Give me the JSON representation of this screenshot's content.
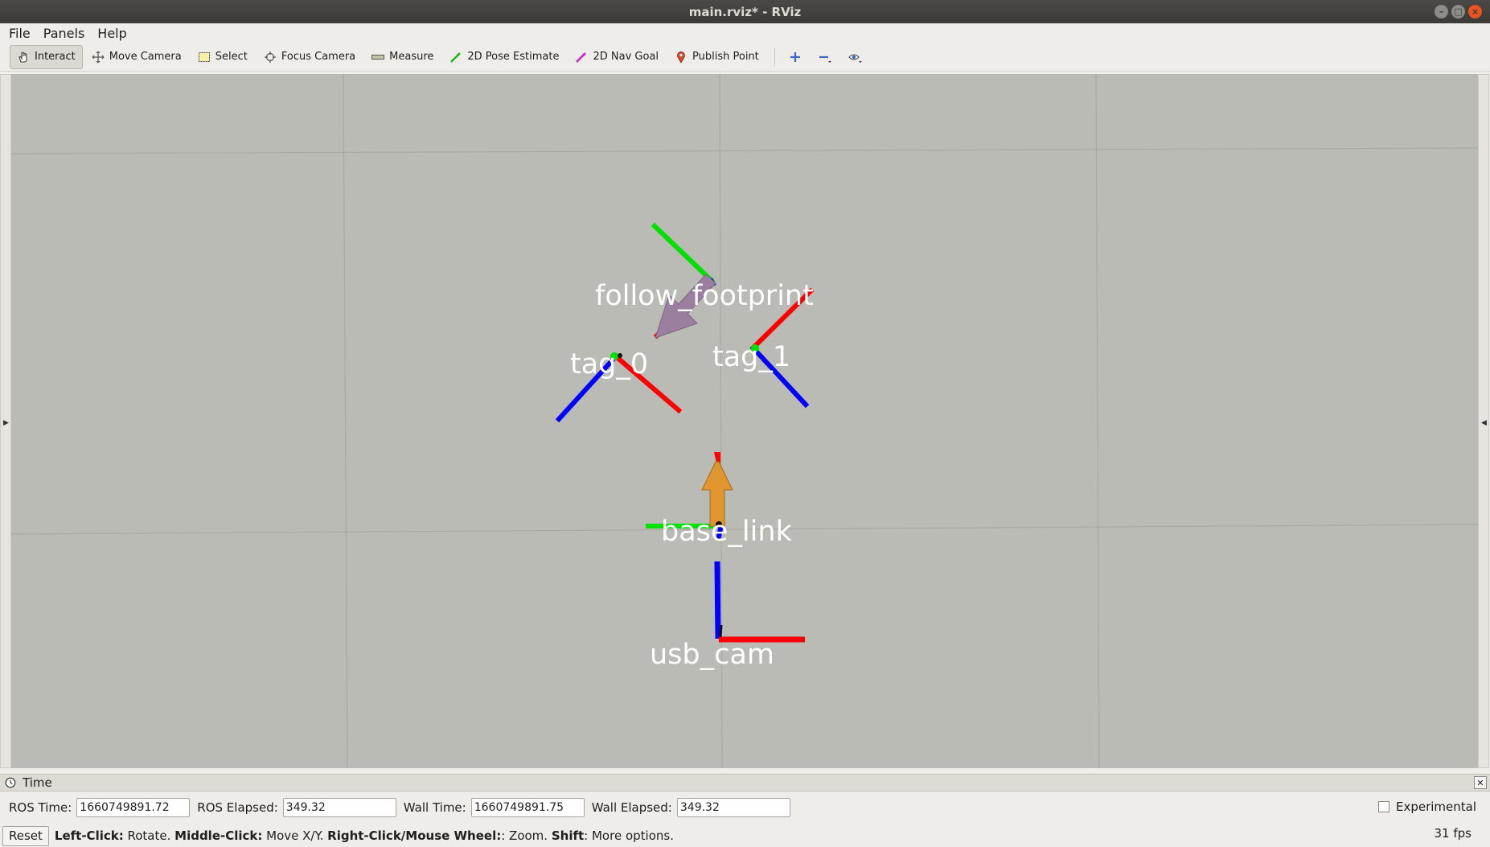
{
  "window": {
    "title": "main.rviz* - RViz"
  },
  "menu": [
    "File",
    "Panels",
    "Help"
  ],
  "toolbar": {
    "interact": "Interact",
    "move_camera": "Move Camera",
    "select": "Select",
    "focus_camera": "Focus Camera",
    "measure": "Measure",
    "pose_estimate": "2D Pose Estimate",
    "nav_goal": "2D Nav Goal",
    "publish_point": "Publish Point"
  },
  "frames": {
    "follow": "follow_footprint",
    "tag0": "tag_0",
    "tag1": "tag_1",
    "base": "base_link",
    "cam": "usb_cam"
  },
  "time_panel": {
    "title": "Time",
    "ros_time_label": "ROS Time:",
    "ros_time": "1660749891.72",
    "ros_elapsed_label": "ROS Elapsed:",
    "ros_elapsed": "349.32",
    "wall_time_label": "Wall Time:",
    "wall_time": "1660749891.75",
    "wall_elapsed_label": "Wall Elapsed:",
    "wall_elapsed": "349.32",
    "experimental": "Experimental"
  },
  "status": {
    "reset": "Reset",
    "h1": "Left-Click:",
    "t1": " Rotate. ",
    "h2": "Middle-Click:",
    "t2": " Move X/Y. ",
    "h3": "Right-Click/Mouse Wheel:",
    "t3": ": Zoom. ",
    "h4": "Shift",
    "t4": ": More options.",
    "fps": "31 fps"
  },
  "colors": {
    "viewport_bg": "#b9bbb4",
    "axis_x": "#ff0000",
    "axis_y": "#00ff00",
    "axis_z": "#0000ff",
    "arrow_follow": "#9a7f9e",
    "arrow_base": "#e0952e"
  }
}
